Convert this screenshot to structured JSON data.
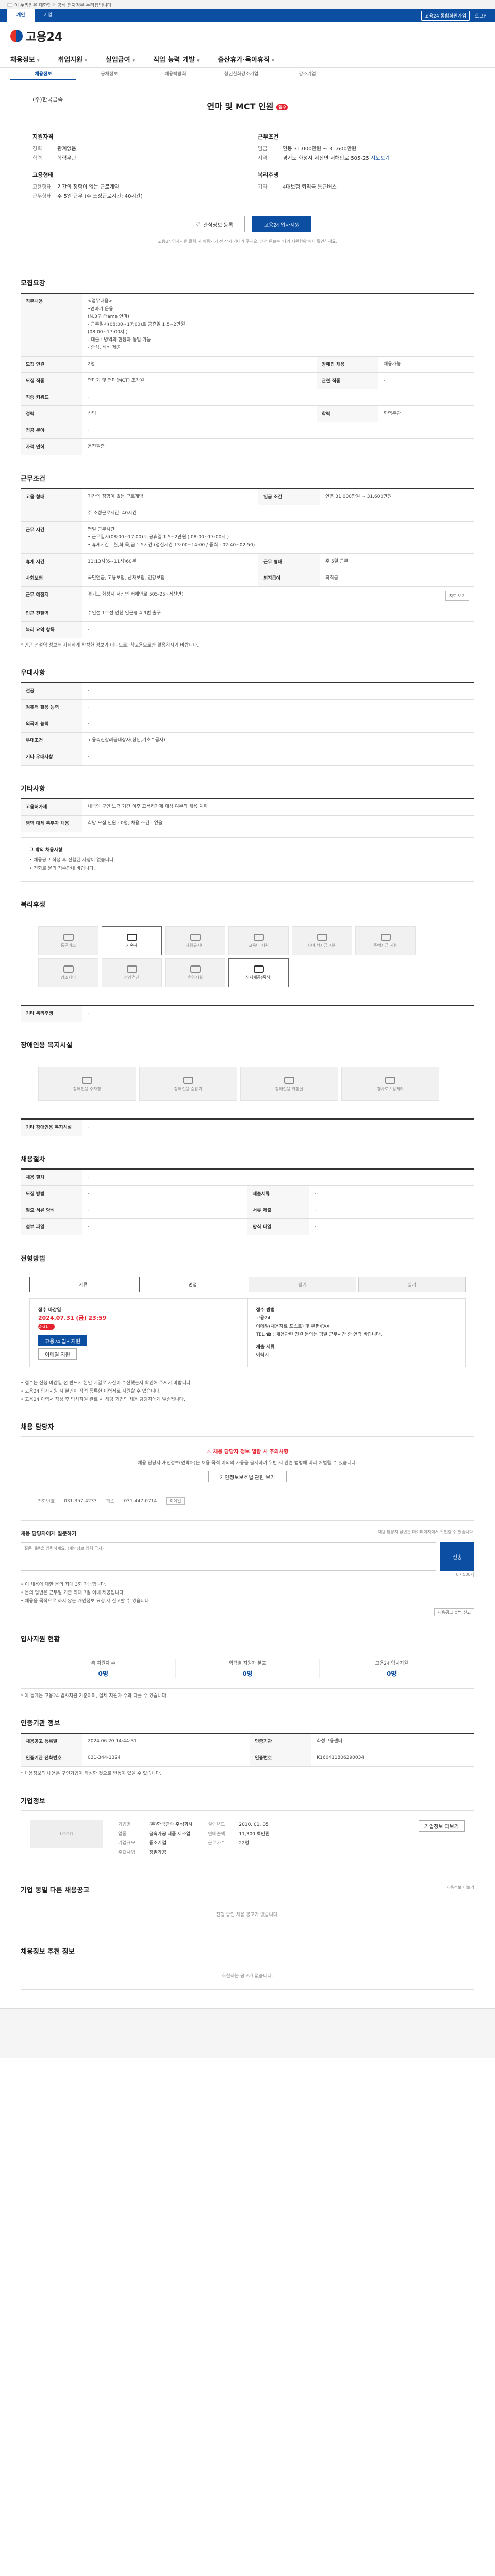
{
  "gov_banner": "이 누리집은 대한민국 공식 전자정부 누리집입니다.",
  "tabbar": {
    "tabs": [
      "개인",
      "기업"
    ],
    "right_links": [
      "고용24 통합회원가입",
      "로그인"
    ]
  },
  "logo": "고용24",
  "gnb": [
    {
      "label": "채용정보",
      "caret": "▾"
    },
    {
      "label": "취업지원",
      "caret": "▾"
    },
    {
      "label": "실업급여",
      "caret": "▾"
    },
    {
      "label": "직업 능력 개발",
      "caret": "▾"
    },
    {
      "label": "출산휴가·육아휴직",
      "caret": "▾"
    }
  ],
  "subnav": [
    "채용정보",
    "공채정보",
    "채용박람회",
    "청년친화강소기업",
    "강소기업"
  ],
  "job": {
    "company_name": "(주)한국금속",
    "title": "연마 및 MCT 인원",
    "apply_badge": "접수중",
    "qualification_title": "지원자격",
    "qual": [
      {
        "k": "경력",
        "v": "관계없음"
      },
      {
        "k": "학력",
        "v": "학력무관"
      }
    ],
    "condition_title": "근무조건",
    "cond": [
      {
        "k": "임금",
        "v": "연봉 31,000만원 ~ 31,600만원"
      },
      {
        "k": "지역",
        "v": "경기도 화성시 서신면 서해안로 505-25",
        "map": "지도보기"
      }
    ],
    "employ_title": "고용형태",
    "employ": [
      {
        "k": "고용형태",
        "v": "기간의 정함이 없는 근로계약"
      },
      {
        "k": "근무형태",
        "v": "주 5일 근무 (주 소정근로시간: 40시간)"
      }
    ],
    "benefit_title": "복리후생",
    "benefit": [
      {
        "k": "기타",
        "v": "4대보험 퇴직금 통근버스"
      }
    ],
    "buttons": {
      "scrap": "관심정보 등록",
      "apply": "고용24 입사지원"
    },
    "note": "고용24 입사지원 클릭 시 이동되기 전 잠시 기다려 주세요. 신청 완료는 '나의 지원현황'에서 확인하세요."
  },
  "recruit": {
    "title": "모집요강",
    "rows": [
      {
        "k": "직무내용",
        "v": "<업무내용>\n•연마기 운용\n(N,3구 Frame 연마)\n- 근무일시(08:00~17:00)토,공휴일 1.5~2만원\n  (08:00~17:00시 )\n- 대졸 : 병역의 현장과 동일 가능\n- 중식, 석식 제공"
      },
      {
        "k": "모집 인원",
        "v": "2명",
        "k2": "장애인 채용",
        "v2": "채용가능"
      },
      {
        "k": "모집 직종",
        "v": "연마기 및 연마(MCT) 조작원",
        "k2": "관련 직종",
        "v2": "-"
      },
      {
        "k": "직종 키워드",
        "v": "-"
      },
      {
        "k": "경력",
        "v": "신입",
        "k2": "학력",
        "v2": "학력무관"
      },
      {
        "k": "전공 분야",
        "v": "-"
      },
      {
        "k": "자격 면허",
        "v": "운전필증"
      }
    ]
  },
  "work": {
    "title": "근무조건",
    "rows": [
      {
        "k": "고용 형태",
        "v": "기간의 정함이 없는 근로계약",
        "k2": "임금 조건",
        "v2": "연봉 31,000만원 ~ 31,600만원"
      },
      {
        "k": "",
        "v": "주 소정근로시간: 40시간"
      },
      {
        "k": "근무 시간",
        "v": "평일 근무시간\n• 근무일시(08:00~17:00)토,공휴일 1.5~2만원 ( 08:00~17:00시 )\n• 휴게시간 : 월,화,목,금 1.5시간 (점심시간 13:00~14:00 / 중식 : 02:40~02:50)"
      },
      {
        "k": "휴게 시간",
        "v": "11:13시(6~11시)60분",
        "k2": "근무 형태",
        "v2": "주 5일 근무"
      },
      {
        "k": "사회보험",
        "v": "국민연금, 고용보험, 산재보험, 건강보험",
        "k2": "퇴직급여",
        "v2": "퇴직금"
      },
      {
        "k": "근무 예정지",
        "v": "경기도 화성시 서신면 서해안로 505-25 (서신면)",
        "btn": "지도 보기"
      },
      {
        "k": "인근 전철역",
        "v": "수인선 1호선 인천 인근형 4 9번 출구"
      },
      {
        "k": "복리 요약 항목",
        "v": "-"
      }
    ],
    "note": "* 인근 전철역 정보는 자세하게 작성한 정보가 아니므로, 참고용으로만 활용하시기 바랍니다."
  },
  "etc": {
    "title": "우대사항",
    "rows": [
      {
        "k": "전공",
        "v": "-"
      },
      {
        "k": "컴퓨터 활용 능력",
        "v": "-"
      },
      {
        "k": "외국어 능력",
        "v": "-"
      },
      {
        "k": "우대조건",
        "v": "고용촉진장려금대상자(장년,기초수급자)"
      },
      {
        "k": "기타 우대사항",
        "v": "-"
      }
    ]
  },
  "other": {
    "title": "기타사항",
    "rows": [
      {
        "k": "고용허가제",
        "v": "내국인 구인 노력 기간 이후 고용허가제 대상 여부와 채용 계획"
      },
      {
        "k": "병역 대체 복무자 채용",
        "v": "희망 모집 인원 : 0명, 채용 조건 : 없음"
      }
    ],
    "notes_title": "그 밖의 채용사항",
    "notes": [
      "• 채용공고 작성 후 진행된 사항이 없습니다.",
      "• 전화로 문의 접수안내 바랍니다."
    ]
  },
  "welfare": {
    "title": "복리후생",
    "items": [
      {
        "label": "통근버스",
        "on": false
      },
      {
        "label": "기숙사",
        "on": true
      },
      {
        "label": "차량유지비",
        "on": false
      },
      {
        "label": "교육비 지원",
        "on": false
      },
      {
        "label": "자녀 학자금 지원",
        "on": false
      },
      {
        "label": "주택자금 지원",
        "on": false
      },
      {
        "label": "경조사비",
        "on": false
      },
      {
        "label": "건강검진",
        "on": false
      },
      {
        "label": "휴양시설",
        "on": false
      },
      {
        "label": "식사제공(중식)",
        "on": true
      }
    ],
    "extra_label": "기타 복리후생",
    "extra_value": "-"
  },
  "disability": {
    "title": "장애인용 복지시설",
    "items": [
      {
        "label": "장애인용 주차장"
      },
      {
        "label": "장애인용 승강기"
      },
      {
        "label": "장애인용 화장실"
      },
      {
        "label": "경사로 / 휠체어"
      }
    ],
    "extra_label": "기타 장애인용 복지시설",
    "extra_value": "-"
  },
  "selection": {
    "title": "채용절차",
    "rows": [
      {
        "k": "채용 절차",
        "v": "-"
      },
      {
        "k": "모집 방법",
        "v": "-",
        "k2": "제출서류",
        "v2": "-"
      },
      {
        "k": "필요 서류 양식",
        "v": "-",
        "k2": "서류 제출",
        "v2": "-"
      },
      {
        "k": "첨부 파일",
        "v": "-",
        "k2": "양식 파일",
        "v2": "-"
      }
    ]
  },
  "apply": {
    "title": "전형방법",
    "methods": [
      {
        "label": "서류",
        "on": true
      },
      {
        "label": "면접",
        "on": true
      },
      {
        "label": "필기",
        "on": false
      },
      {
        "label": "실기",
        "on": false
      }
    ],
    "period_label": "접수 마감일",
    "period_value": "2024.07.31 (금) 23:59",
    "dday": "D-31",
    "method_label": "접수 방법",
    "method_lines": [
      "고용24",
      "이메일(채용자료 포스트) 및 우편/FAX",
      "TEL ☎ : 채용관련 민원 문의는 평일 근무시간 중 연락 바랍니다."
    ],
    "form_label": "제출 서류",
    "form_value": "이력서",
    "btn_apply": "고용24 입사지원",
    "btn_email": "이메일 지원",
    "notes": [
      "• 접수는 신청 마감일 전 반드시 본인 메일로 자신이 수신했는지 확인해 주시기 바랍니다.",
      "• 고용24 입사지원 시 본인이 직접 등록한 이력서로 지원할 수 있습니다.",
      "• 고용24 이력서 작성 후 입사지원 완료 시 해당 기업의 채용 담당자에게 발송됩니다."
    ]
  },
  "contact": {
    "title": "채용 담당자",
    "warn": "채용 담당자 정보 열람 시 주의사항",
    "desc": "채용 담당자 개인정보(연락처)는 채용 목적 이외의 사용을 금지하며 위반 시 관련 법령에 따라 처벌될 수 있습니다.",
    "btn": "개인정보보호법 관련 보기",
    "rows": [
      {
        "k": "전화번호",
        "v": "031-357-4233"
      },
      {
        "k": "팩스",
        "v": "031-447-0714"
      }
    ],
    "btn_email": "이메일",
    "qa_title": "채용 담당자에게 질문하기",
    "qa_note": "채용 담당자 답변은 마이페이지에서 확인할 수 있습니다.",
    "qa_placeholder": "질문 내용을 입력하세요. (개인정보 입력 금지)",
    "qa_count": "0 / 500자",
    "qa_send": "전송",
    "qa_notes": [
      "• 이 채용에 대한 문의 최대 3회 가능합니다.",
      "• 문의 답변은 근무일 기준 최대 7일 이내 제공됩니다.",
      "• 채용을 목적으로 하지 않는 개인정보 요청 시 신고할 수 있습니다."
    ],
    "report": "채용공고 불법 신고"
  },
  "stats": {
    "title": "입사지원 현황",
    "items": [
      {
        "label": "총 지원자 수",
        "value": "0명"
      },
      {
        "label": "학력별 지원자 분포",
        "value": "0명"
      },
      {
        "label": "고용24 입사지원",
        "value": "0명"
      }
    ],
    "note": "* 이 통계는 고용24 입사지원 기준이며, 실제 지원자 수와 다를 수 있습니다."
  },
  "manager": {
    "title": "인증기관 정보",
    "rows": [
      {
        "k": "채용공고 등록일",
        "v": "2024.06.20 14:44:31",
        "k2": "인증기관",
        "v2": "화성고용센터"
      },
      {
        "k": "인증기관 전화번호",
        "v": "031-344-1324",
        "k2": "인증번호",
        "v2": "K160411806290034"
      }
    ],
    "note": "* 채용정보의 내용은 구인기업이 작성한 것으로 변동이 있을 수 있습니다."
  },
  "company": {
    "title": "기업정보",
    "logo": "LOGO",
    "fields_left": [
      {
        "k": "기업명",
        "v": "(주)한국금속 주식회사"
      },
      {
        "k": "업종",
        "v": "금속가공 제품 제조업"
      },
      {
        "k": "기업규모",
        "v": "중소기업"
      },
      {
        "k": "주요사업",
        "v": "정밀가공"
      }
    ],
    "fields_right": [
      {
        "k": "설립년도",
        "v": "2010. 01. 05"
      },
      {
        "k": "연매출액",
        "v": "11,300 백만원"
      },
      {
        "k": "근로자수",
        "v": "22명"
      }
    ],
    "btn_more": "기업정보 더보기"
  },
  "similar": {
    "title": "기업 동일 다른 채용공고",
    "empty": "진행 중인 채용 공고가 없습니다.",
    "more": "채용정보 더보기"
  },
  "recommend": {
    "title": "채용정보 추천 정보",
    "empty": "추천하는 공고가 없습니다."
  },
  "colors": {
    "primary": "#0b4ea2",
    "accent": "#e6222e"
  }
}
